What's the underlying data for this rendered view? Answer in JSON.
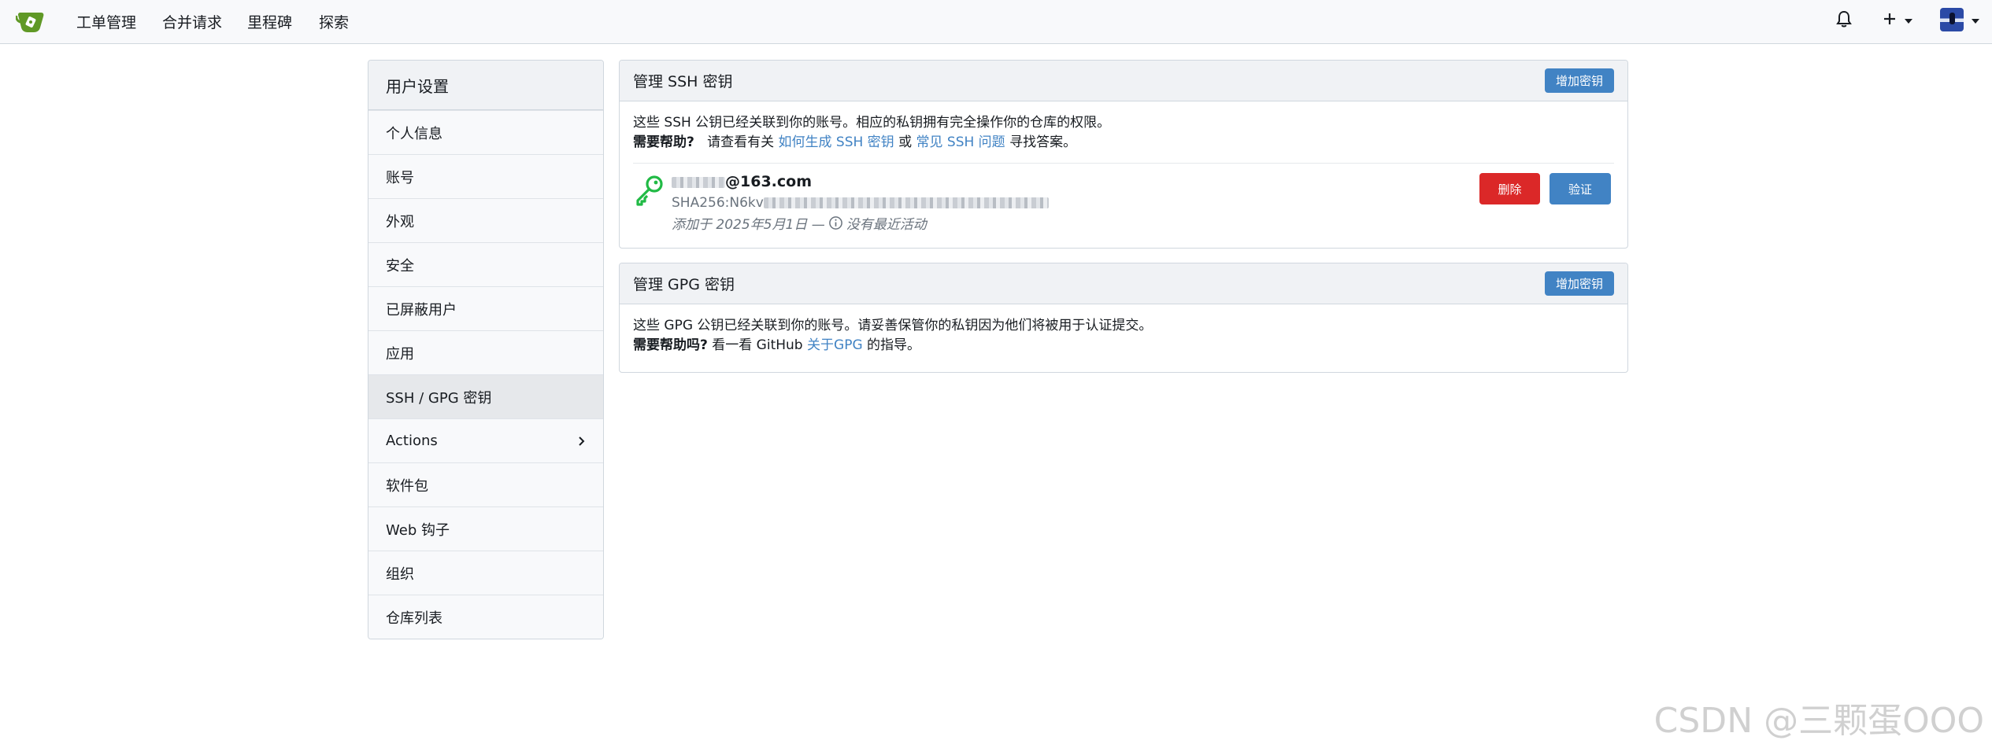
{
  "navbar": {
    "links": [
      "工单管理",
      "合并请求",
      "里程碑",
      "探索"
    ],
    "icons": [
      "gitea-logo-icon",
      "bell-icon",
      "plus-icon",
      "avatar"
    ]
  },
  "sidebar": {
    "header": "用户设置",
    "items": [
      {
        "label": "个人信息"
      },
      {
        "label": "账号"
      },
      {
        "label": "外观"
      },
      {
        "label": "安全"
      },
      {
        "label": "已屏蔽用户"
      },
      {
        "label": "应用"
      },
      {
        "label": "SSH / GPG 密钥",
        "active": true
      },
      {
        "label": "Actions",
        "has_submenu": true
      },
      {
        "label": "软件包"
      },
      {
        "label": "Web 钩子"
      },
      {
        "label": "组织"
      },
      {
        "label": "仓库列表"
      }
    ]
  },
  "ssh": {
    "title": "管理 SSH 密钥",
    "add_button": "增加密钥",
    "desc_line1": "这些 SSH 公钥已经关联到你的账号。相应的私钥拥有完全操作你的仓库的权限。",
    "help_label": "需要帮助?",
    "help_prefix": "请查看有关",
    "help_link1": "如何生成 SSH 密钥",
    "help_or": "或",
    "help_link2": "常见 SSH 问题",
    "help_suffix": "寻找答案。",
    "key": {
      "email_suffix": "@163.com",
      "fingerprint_prefix": "SHA256:N6kv",
      "meta": "添加于 2025年5月1日 —",
      "activity": "没有最近活动",
      "delete_button": "删除",
      "verify_button": "验证"
    }
  },
  "gpg": {
    "title": "管理 GPG 密钥",
    "add_button": "增加密钥",
    "desc_line1": "这些 GPG 公钥已经关联到你的账号。请妥善保管你的私钥因为他们将被用于认证提交。",
    "help_label": "需要帮助吗?",
    "help_prefix": "看一看 GitHub",
    "help_link": "关于GPG",
    "help_suffix": "的指导。"
  },
  "watermark": "CSDN @三颗蛋OOO",
  "colors": {
    "accent": "#4183c4",
    "danger": "#db2828",
    "key_green": "#21ba45"
  }
}
